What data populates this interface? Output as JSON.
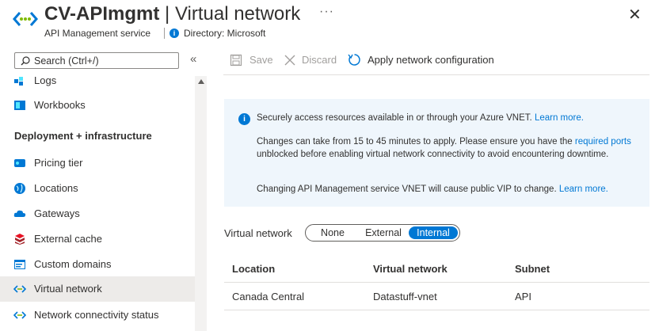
{
  "header": {
    "title_resource": "CV-APImgmt",
    "title_separator": "|",
    "title_page": "Virtual network",
    "subtitle": "API Management service",
    "directory": "Directory: Microsoft",
    "more_label": "···",
    "close_label": "✕"
  },
  "sidebar": {
    "search_placeholder": "Search (Ctrl+/)",
    "collapse_label": "«",
    "section_deployment": "Deployment + infrastructure",
    "items": [
      {
        "label": "Logs",
        "icon": "logs-icon"
      },
      {
        "label": "Workbooks",
        "icon": "workbooks-icon"
      },
      {
        "label": "Pricing tier",
        "icon": "pricing-tier-icon"
      },
      {
        "label": "Locations",
        "icon": "globe-icon"
      },
      {
        "label": "Gateways",
        "icon": "cloud-icon"
      },
      {
        "label": "External cache",
        "icon": "cache-icon"
      },
      {
        "label": "Custom domains",
        "icon": "custom-domains-icon"
      },
      {
        "label": "Virtual network",
        "icon": "vnet-icon",
        "active": true
      },
      {
        "label": "Network connectivity status",
        "icon": "vnet-icon"
      }
    ]
  },
  "toolbar": {
    "save_label": "Save",
    "discard_label": "Discard",
    "apply_label": "Apply network configuration"
  },
  "info": {
    "line1": "Securely access resources available in or through your Azure VNET.",
    "line1_link": "Learn more.",
    "line2a": "Changes can take from 15 to 45 minutes to apply. Please ensure you have the",
    "line2_link": "required ports",
    "line2b": "unblocked before enabling virtual network connectivity to avoid encountering downtime.",
    "line3": "Changing API Management service VNET will cause public VIP to change.",
    "line3_link": "Learn more."
  },
  "vnet": {
    "label": "Virtual network",
    "options": [
      "None",
      "External",
      "Internal"
    ],
    "selected": "Internal"
  },
  "table": {
    "columns": [
      "Location",
      "Virtual network",
      "Subnet"
    ],
    "rows": [
      [
        "Canada Central",
        "Datastuff-vnet",
        "API"
      ]
    ]
  },
  "colors": {
    "accent": "#0078d4",
    "info_bg": "#eff6fc",
    "active_bg": "#edebe9"
  }
}
